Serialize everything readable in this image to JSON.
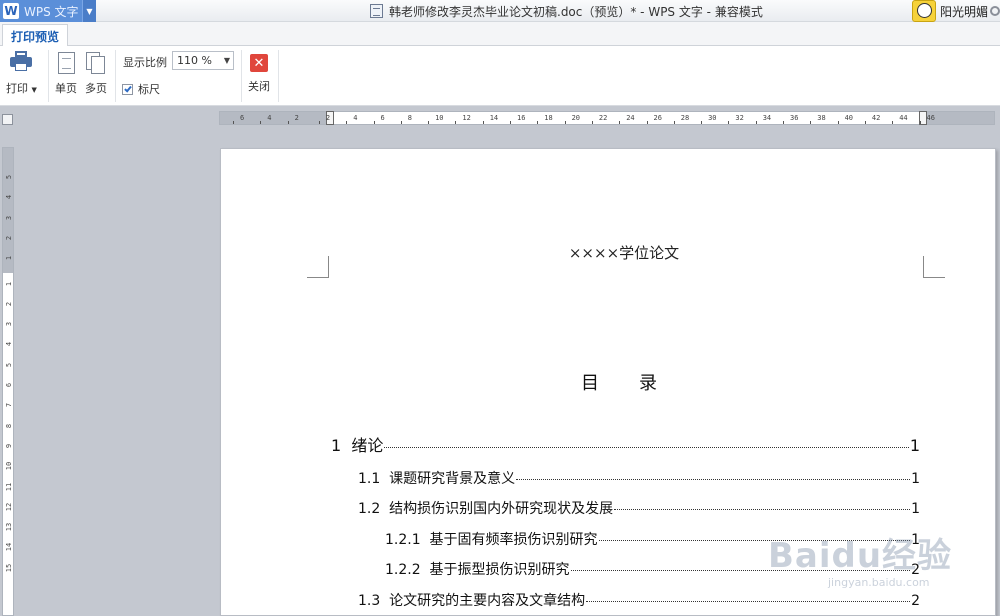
{
  "app": {
    "name": "WPS 文字",
    "logo_letter": "W"
  },
  "window": {
    "title": "韩老师修改李灵杰毕业论文初稿.doc（预览）* - WPS 文字 - 兼容模式"
  },
  "user": {
    "name": "阳光明媚"
  },
  "ribbon": {
    "active_tab": "打印预览",
    "print_label": "打印",
    "single_page_label": "单页",
    "multi_page_label": "多页",
    "zoom_label": "显示比例",
    "zoom_value": "110 %",
    "ruler_label": "标尺",
    "ruler_checked": true,
    "close_label": "关闭"
  },
  "ruler": {
    "horizontal_ticks": [
      "6",
      "4",
      "2",
      "2",
      "4",
      "6",
      "8",
      "10",
      "12",
      "14",
      "16",
      "18",
      "20",
      "22",
      "24",
      "26",
      "28",
      "30",
      "32",
      "34",
      "36",
      "38",
      "40",
      "42",
      "44",
      "46"
    ],
    "vertical_ticks": [
      "5",
      "4",
      "3",
      "2",
      "1",
      "1",
      "2",
      "3",
      "4",
      "5",
      "6",
      "7",
      "8",
      "9",
      "10",
      "11",
      "12",
      "13",
      "14",
      "15"
    ]
  },
  "document": {
    "header": "××××学位论文",
    "toc_title_chars": [
      "目",
      "录"
    ],
    "toc": [
      {
        "num": "1  ",
        "label": "绪论",
        "page": "1",
        "level": 1
      },
      {
        "num": "1.1  ",
        "label": "课题研究背景及意义",
        "page": "1",
        "level": 2
      },
      {
        "num": "1.2  ",
        "label": "结构损伤识别国内外研究现状及发展",
        "page": "1",
        "level": 2
      },
      {
        "num": "1.2.1  ",
        "label": "基于固有频率损伤识别研究",
        "page": "1",
        "level": 3
      },
      {
        "num": "1.2.2  ",
        "label": "基于振型损伤识别研究",
        "page": "2",
        "level": 3
      },
      {
        "num": "1.3  ",
        "label": "论文研究的主要内容及文章结构",
        "page": "2",
        "level": 2
      }
    ]
  },
  "watermark": {
    "text": "Baidu经验",
    "sub": "jingyan.baidu.com"
  }
}
